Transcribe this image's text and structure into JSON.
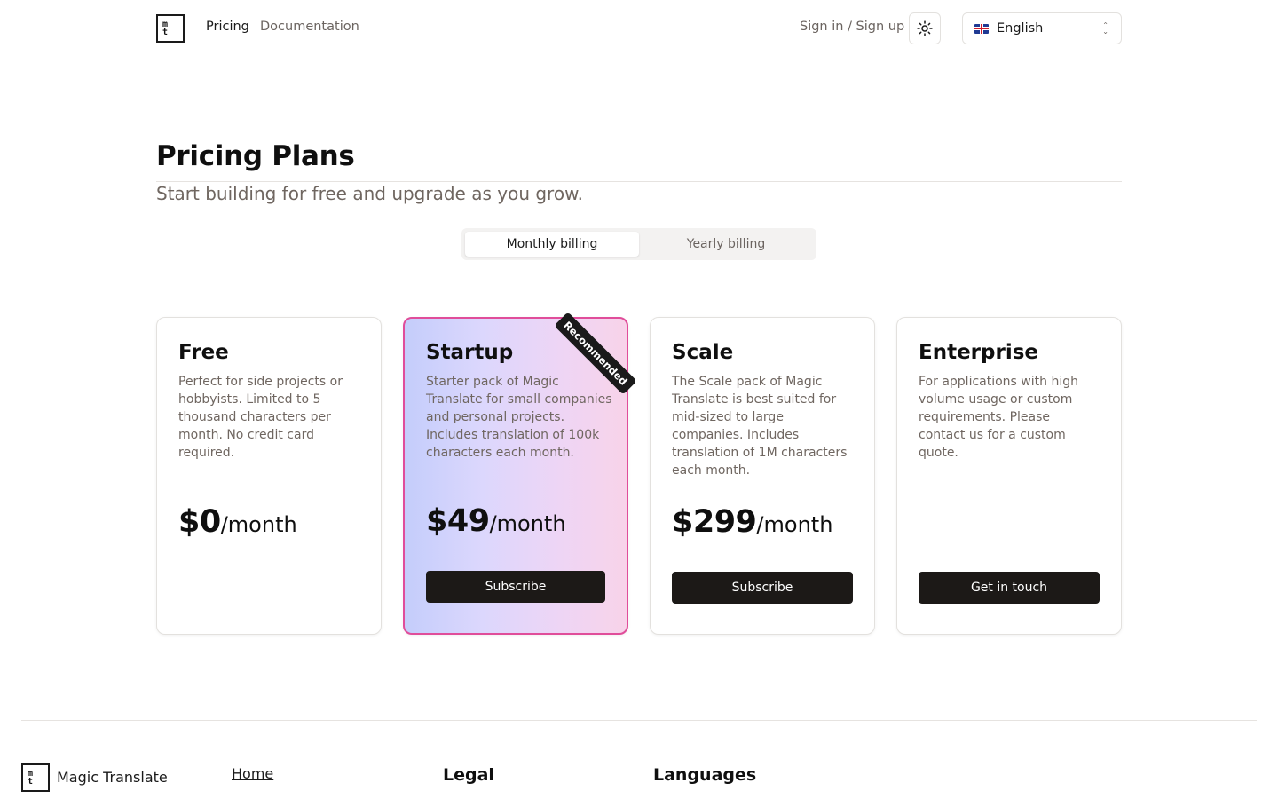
{
  "header": {
    "logo_top": "m",
    "logo_bottom": "t",
    "nav": {
      "pricing": "Pricing",
      "documentation": "Documentation"
    },
    "signin": "Sign in / Sign up",
    "theme_icon": "sun-icon",
    "language": {
      "flag": "uk-flag-icon",
      "selected": "English"
    }
  },
  "hero": {
    "title": "Pricing Plans",
    "subtitle": "Start building for free and upgrade as you grow."
  },
  "billing": {
    "monthly": "Monthly billing",
    "yearly": "Yearly billing",
    "selected": "monthly"
  },
  "plans": [
    {
      "name": "Free",
      "description": "Perfect for side projects or hobbyists. Limited to 5 thousand characters per month. No credit card required.",
      "price": "$0",
      "period": "/month"
    },
    {
      "name": "Startup",
      "description": "Starter pack of Magic Translate for small companies and personal projects. Includes translation of 100k characters each month.",
      "price": "$49",
      "period": "/month",
      "button": "Subscribe",
      "badge": "Recommended",
      "highlight_color": "#e04d9a"
    },
    {
      "name": "Scale",
      "description": "The Scale pack of Magic Translate is best suited for mid-sized to large companies. Includes translation of 1M characters each month.",
      "price": "$299",
      "period": "/month",
      "button": "Subscribe"
    },
    {
      "name": "Enterprise",
      "description": "For applications with high volume usage or custom requirements. Please contact us for a custom quote.",
      "button": "Get in touch"
    }
  ],
  "footer": {
    "brand": "Magic Translate",
    "home": "Home",
    "legal": "Legal",
    "languages": "Languages"
  }
}
